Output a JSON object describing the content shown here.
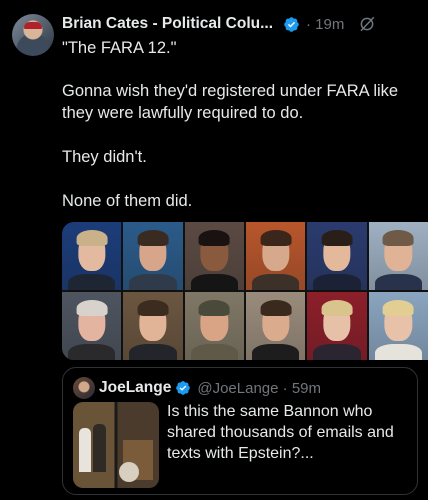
{
  "post": {
    "author": "Brian Cates - Political Colu...",
    "time": "· 19m",
    "lines": [
      "\"The FARA 12.\"",
      "Gonna wish they'd registered under FARA like they were lawfully required to do.",
      "They didn't.",
      "None of them did."
    ]
  },
  "collage": {
    "tiles": [
      {
        "bg": "#1c3d7a",
        "skin": "#e3b9a0",
        "hair": "#c9b18a",
        "suit": "#1f2633"
      },
      {
        "bg": "#2b5b8a",
        "skin": "#d7a58a",
        "hair": "#3a2b22",
        "suit": "#2f3b4a"
      },
      {
        "bg": "#5b4a43",
        "skin": "#8a5a3e",
        "hair": "#1a1210",
        "suit": "#151515"
      },
      {
        "bg": "#b8562c",
        "skin": "#d6a98c",
        "hair": "#3a261a",
        "suit": "#3b3128"
      },
      {
        "bg": "#2a3b6e",
        "skin": "#e4b89b",
        "hair": "#2a1e18",
        "suit": "#1b2235"
      },
      {
        "bg": "#9eb0c2",
        "skin": "#e0b296",
        "hair": "#6e5a46",
        "suit": "#28324a"
      },
      {
        "bg": "#4e5560",
        "skin": "#e3b5a0",
        "hair": "#d7d2cb",
        "suit": "#2a2a2c"
      },
      {
        "bg": "#6b5640",
        "skin": "#e1b497",
        "hair": "#3c2c20",
        "suit": "#23252b"
      },
      {
        "bg": "#807866",
        "skin": "#d9a486",
        "hair": "#4a4a3a",
        "suit": "#5f5a48"
      },
      {
        "bg": "#9a8c7c",
        "skin": "#dbab8e",
        "hair": "#3a2a1e",
        "suit": "#1d1d1d"
      },
      {
        "bg": "#8c1f2a",
        "skin": "#e7c0a8",
        "hair": "#d9c48e",
        "suit": "#2a2530"
      },
      {
        "bg": "#8aa5c0",
        "skin": "#e8c2a8",
        "hair": "#e2cd93",
        "suit": "#e6e2dc"
      }
    ]
  },
  "quote": {
    "name": "JoeLange",
    "handle": "@JoeLange · 59m",
    "text": "Is this the same Bannon who shared thousands of emails and texts with Epstein?..."
  },
  "colors": {
    "background": "#000000",
    "text": "#e7e9ea",
    "muted": "#71767b",
    "verified": "#1d9bf0",
    "border": "#2f3336"
  },
  "icons": [
    "verified-badge-icon",
    "grok-icon"
  ]
}
